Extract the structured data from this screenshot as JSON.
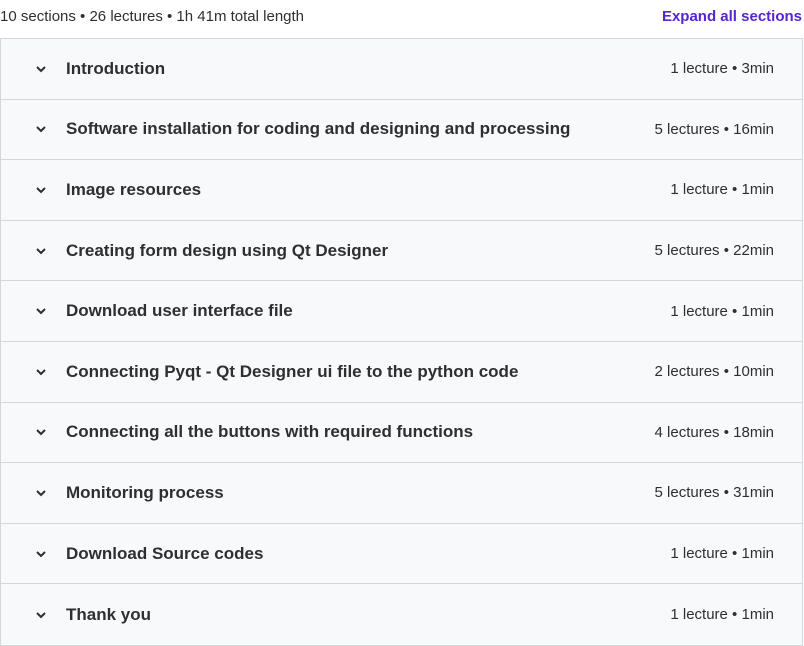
{
  "summary": "10 sections • 26 lectures • 1h 41m total length",
  "expand_label": "Expand all sections",
  "sections": [
    {
      "title": "Introduction",
      "meta": "1 lecture • 3min"
    },
    {
      "title": "Software installation for coding and designing and processing",
      "meta": "5 lectures • 16min"
    },
    {
      "title": "Image resources",
      "meta": "1 lecture • 1min"
    },
    {
      "title": "Creating form design using Qt Designer",
      "meta": "5 lectures • 22min"
    },
    {
      "title": "Download user interface file",
      "meta": "1 lecture • 1min"
    },
    {
      "title": "Connecting Pyqt - Qt Designer ui file to the python code",
      "meta": "2 lectures • 10min"
    },
    {
      "title": "Connecting all the buttons with required functions",
      "meta": "4 lectures • 18min"
    },
    {
      "title": "Monitoring process",
      "meta": "5 lectures • 31min"
    },
    {
      "title": "Download Source codes",
      "meta": "1 lecture • 1min"
    },
    {
      "title": "Thank you",
      "meta": "1 lecture • 1min"
    }
  ],
  "icons": {
    "chevron": "chevron-down-icon"
  },
  "colors": {
    "accent": "#5624d0",
    "row_bg": "#f7f9fa",
    "border": "#d1d7dc",
    "text": "#2d2f31"
  }
}
